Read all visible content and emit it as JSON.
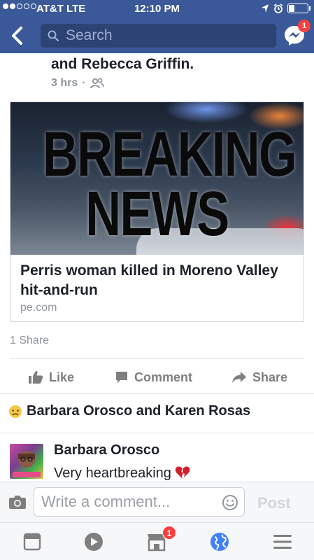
{
  "status_bar": {
    "carrier": "AT&T  LTE",
    "time": "12:10 PM",
    "battery_level": 0.3
  },
  "nav": {
    "search_placeholder": "Search",
    "messenger_badge": "1"
  },
  "post": {
    "header_text": "and Rebecca Griffin.",
    "time_ago": "3 hrs",
    "audience_icon": "friends-icon",
    "link": {
      "image_line1": "BREAKING",
      "image_line2": "NEWS",
      "title": "Perris woman killed in Moreno Valley hit-and-run",
      "domain": "pe.com"
    },
    "share_count": "1 Share",
    "actions": {
      "like": "Like",
      "comment": "Comment",
      "share": "Share"
    },
    "reactors": "Barbara Orosco and Karen Rosas",
    "reaction_icon": "sad-face-icon"
  },
  "comment": {
    "author": "Barbara Orosco",
    "text": "Very heartbreaking",
    "emoji": "broken-heart-icon"
  },
  "composer": {
    "placeholder": "Write a comment...",
    "post_label": "Post"
  },
  "tab_bar": {
    "items": [
      "news-feed-icon",
      "video-icon",
      "marketplace-icon",
      "notifications-globe-icon",
      "menu-icon"
    ],
    "marketplace_badge": "1"
  },
  "colors": {
    "brand": "#3b5998",
    "badge": "#fa3e3e",
    "notifications_active": "#4080ff"
  }
}
